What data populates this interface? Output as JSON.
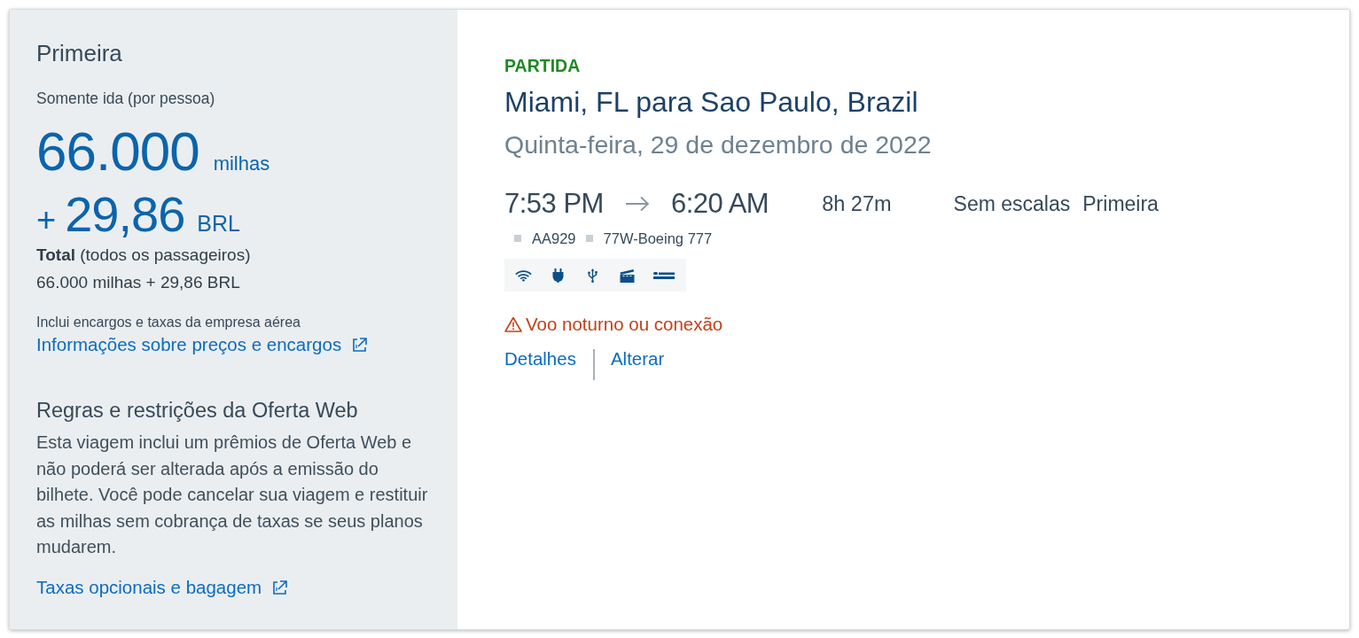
{
  "fare_panel": {
    "cabin": "Primeira",
    "trip_type": "Somente ida (por pessoa)",
    "miles": "66.000",
    "miles_unit": "milhas",
    "plus": "+",
    "cash": "29,86",
    "currency": "BRL",
    "total_label": "**Total** (todos os passageiros)",
    "total_value": "66.000 milhas + 29,86 BRL",
    "fees_note": "Inclui encargos e taxas da empresa aérea",
    "fees_link": "Informações sobre preços e encargos"
  },
  "rules": {
    "title": "Regras e restrições da Oferta Web",
    "body": "Esta viagem inclui um prêmios de Oferta Web e não poderá ser alterada após a emissão do bilhete. Você pode cancelar sua viagem e restituir as milhas sem cobrança de taxas se seus planos mudarem.",
    "link": "Taxas opcionais e bagagem"
  },
  "flight": {
    "direction": "PARTIDA",
    "route": "Miami, FL para Sao Paulo, Brazil",
    "date": "Quinta-feira, 29 de dezembro de 2022",
    "depart_time": "7:53 PM",
    "arrive_time": "6:20 AM",
    "duration": "8h 27m",
    "stops": "Sem escalas",
    "cabin": "Primeira",
    "details": [
      "AA929",
      "77W-Boeing 777"
    ],
    "amenities": [
      {
        "kind": "wifi"
      },
      {
        "kind": "power"
      },
      {
        "kind": "usb"
      },
      {
        "kind": "video"
      },
      {
        "kind": "flat_bed"
      }
    ],
    "notice": "Voo noturno ou conexão",
    "actions": [
      "Detalhes",
      "Alterar"
    ]
  }
}
